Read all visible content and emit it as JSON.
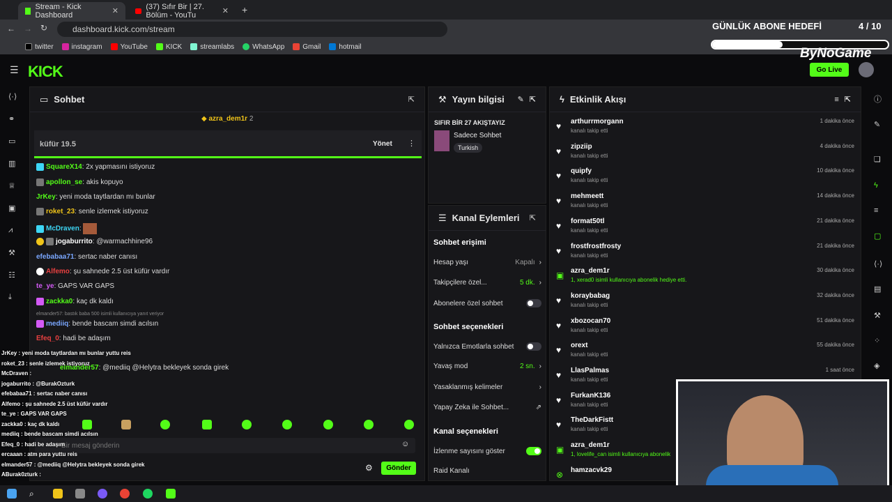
{
  "browser": {
    "tabs": [
      {
        "title": "Stream - Kick Dashboard",
        "active": true
      },
      {
        "title": "(37) Sıfır Bir | 27. Bölüm - YouTu",
        "active": false
      }
    ],
    "url": "dashboard.kick.com/stream",
    "bookmarks": [
      "twitter",
      "instagram",
      "YouTube",
      "KICK",
      "streamlabs",
      "WhatsApp",
      "Gmail",
      "hotmail"
    ]
  },
  "overlay": {
    "goal_title": "GÜNLÜK ABONE HEDEFİ",
    "goal_count": "4 / 10",
    "goal_progress": 0.4,
    "brand": "ByNoGame"
  },
  "header": {
    "logo": "KICK",
    "golive_label": "Go Live"
  },
  "chat": {
    "title": "Sohbet",
    "pinned_user": "azra_dem1r",
    "pinned_count": "2",
    "poll_title": "küfür 19.5",
    "poll_manage": "Yönet",
    "messages": [
      {
        "user": "SquareX14",
        "text": "2x yapmasını istiyoruz",
        "color": "#53fc18"
      },
      {
        "user": "apollon_se",
        "text": "akis kopuyo",
        "color": "#53fc18"
      },
      {
        "user": "JrKey",
        "text": "yeni moda taytlardan mı bunlar",
        "color": "#53fc18"
      },
      {
        "user": "roket_23",
        "text": "senle izlemek istiyoruz",
        "color": "#f0c419"
      },
      {
        "user": "McDraven",
        "text": "",
        "color": "#3dd6f5"
      },
      {
        "user": "jogaburrito",
        "text": "@warmachhine96",
        "color": "#ffffff"
      },
      {
        "user": "efebabaa71",
        "text": "sertac naber canısı",
        "color": "#7aa7ff"
      },
      {
        "user": "Alfemo",
        "text": "şu sahnede 2.5 üst küfür vardır",
        "color": "#e84040"
      },
      {
        "user": "te_ye",
        "text": "GAPS VAR GAPS",
        "color": "#d35af5"
      },
      {
        "user": "zackka0",
        "text": "kaç dk kaldı",
        "color": "#53fc18"
      },
      {
        "user": "mediiq",
        "text": "bende bascam simdi acılsın",
        "color": "#7aa7ff"
      },
      {
        "user": "Efeq_0",
        "text": "hadi be adaşım",
        "color": "#e84040"
      },
      {
        "user": "elmander57",
        "text": "@mediiq @Helytra bekleyek sonda girek",
        "color": "#53fc18"
      }
    ],
    "reply_hint": "elmander57: bastık baba 500 isimli kullanıcıya yanıt veriyor",
    "input_placeholder": "Bir mesaj gönderin",
    "send_label": "Gönder"
  },
  "overlay_chat": [
    "JrKey : yeni moda taytlardan mı bunlar yuttu reis",
    "roket_23 : senle izlemek istiyoruz",
    "McDraven :",
    "jogaburrito : @BurakOzturk",
    "efebabaa71 : sertac naber canısı",
    "Alfemo : şu sahnede 2.5 üst küfür vardır",
    "te_ye : GAPS VAR GAPS",
    "zackka0 : kaç dk kaldı",
    "mediiq : bende bascam simdi acılsın",
    "Efeq_0 : hadi be adaşım",
    "ercaaan : atm para yuttu reis",
    "elmander57 : @mediiq @Helytra bekleyek sonda girek",
    "ABurak0zturk :"
  ],
  "stream_info": {
    "title": "Yayın bilgisi",
    "stream_title": "SIFIR BİR 27 AKIŞTAYIZ",
    "category": "Sadece Sohbet",
    "tag": "Turkish"
  },
  "channel_actions": {
    "title": "Kanal Eylemleri",
    "chat_access_title": "Sohbet erişimi",
    "account_age": "Hesap yaşı",
    "account_age_val": "Kapalı",
    "followers_only": "Takipçilere özel...",
    "followers_only_val": "5 dk.",
    "subs_only": "Abonelere özel sohbet",
    "chat_options_title": "Sohbet seçenekleri",
    "emotes_only": "Yalnızca Emotlarla sohbet",
    "slow_mode": "Yavaş mod",
    "slow_mode_val": "2 sn.",
    "banned_words": "Yasaklanmış kelimeler",
    "ai_chat": "Yapay Zeka ile Sohbet...",
    "channel_options_title": "Kanal seçenekleri",
    "show_viewers": "İzlenme sayısını göster",
    "raid": "Raid Kanalı"
  },
  "activity": {
    "title": "Etkinlik Akışı",
    "events": [
      {
        "user": "arthurrmorgann",
        "text": "kanalı takip etti",
        "time": "1 dakika önce",
        "type": "follow"
      },
      {
        "user": "zipziip",
        "text": "kanalı takip etti",
        "time": "4 dakika önce",
        "type": "follow"
      },
      {
        "user": "quipfy",
        "text": "kanalı takip etti",
        "time": "10 dakika önce",
        "type": "follow"
      },
      {
        "user": "mehmeett",
        "text": "kanalı takip etti",
        "time": "14 dakika önce",
        "type": "follow"
      },
      {
        "user": "format50tl",
        "text": "kanalı takip etti",
        "time": "21 dakika önce",
        "type": "follow"
      },
      {
        "user": "frostfrostfrosty",
        "text": "kanalı takip etti",
        "time": "21 dakika önce",
        "type": "follow"
      },
      {
        "user": "azra_dem1r",
        "text": "1, xerad0 isimli kullanıcıya abonelik hediye etti.",
        "time": "30 dakika önce",
        "type": "gift"
      },
      {
        "user": "koraybabag",
        "text": "kanalı takip etti",
        "time": "32 dakika önce",
        "type": "follow"
      },
      {
        "user": "xbozocan70",
        "text": "kanalı takip etti",
        "time": "51 dakika önce",
        "type": "follow"
      },
      {
        "user": "orext",
        "text": "kanalı takip etti",
        "time": "55 dakika önce",
        "type": "follow"
      },
      {
        "user": "LlasPalmas",
        "text": "kanalı takip etti",
        "time": "1 saat önce",
        "type": "follow"
      },
      {
        "user": "FurkanK136",
        "text": "kanalı takip etti",
        "time": "",
        "type": "follow"
      },
      {
        "user": "TheDarkFistt",
        "text": "kanalı takip etti",
        "time": "",
        "type": "follow"
      },
      {
        "user": "azra_dem1r",
        "text": "1, lovelife_can isimli kullanıcıya abonelik",
        "time": "",
        "type": "gift"
      },
      {
        "user": "hamzacvk29",
        "text": "",
        "time": "",
        "type": "sub"
      }
    ]
  },
  "colors": {
    "accent": "#53fc18",
    "panel": "#17171a",
    "background": "#0b0b0d"
  }
}
